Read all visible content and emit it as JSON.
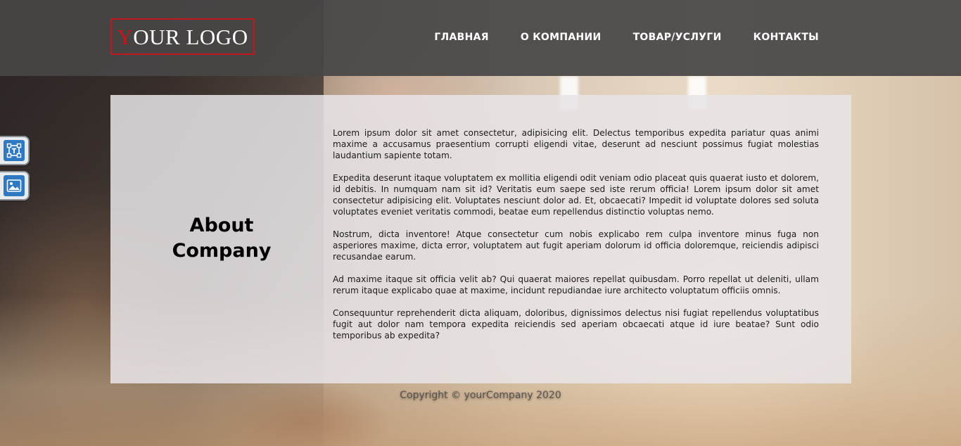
{
  "header": {
    "logo_first": "Y",
    "logo_rest": "OUR LOGO",
    "nav": [
      {
        "label": "ГЛАВНАЯ"
      },
      {
        "label": "О КОМПАНИИ"
      },
      {
        "label": "ТОВАР/УСЛУГИ"
      },
      {
        "label": "КОНТАКТЫ"
      }
    ]
  },
  "side_tools": [
    {
      "icon": "text-frame-icon"
    },
    {
      "icon": "image-icon"
    }
  ],
  "about": {
    "title_line1": "About",
    "title_line2": "Company",
    "paragraphs": [
      "Lorem ipsum dolor sit amet consectetur, adipisicing elit. Delectus temporibus expedita pariatur quas animi maxime a accusamus praesentium corrupti eligendi vitae, deserunt ad nesciunt possimus fugiat molestias laudantium sapiente totam.",
      "Expedita deserunt itaque voluptatem ex mollitia eligendi odit veniam odio placeat quis quaerat iusto et dolorem, id debitis. In numquam nam sit id? Veritatis eum saepe sed iste rerum officia! Lorem ipsum dolor sit amet consectetur adipisicing elit. Voluptates nesciunt dolor ad. Et, obcaecati? Impedit id voluptate dolores sed soluta voluptates eveniet veritatis commodi, beatae eum repellendus distinctio voluptas nemo.",
      "Nostrum, dicta inventore! Atque consectetur cum nobis explicabo rem culpa inventore minus fuga non asperiores maxime, dicta error, voluptatem aut fugit aperiam dolorum id officia doloremque, reiciendis adipisci recusandae earum.",
      "Ad maxime itaque sit officia velit ab? Qui quaerat maiores repellat quibusdam. Porro repellat ut deleniti, ullam rerum itaque explicabo quae at maxime, incidunt repudiandae iure architecto voluptatum officiis omnis.",
      "Consequuntur reprehenderit dicta aliquam, doloribus, dignissimos delectus nisi fugiat repellendus voluptatibus fugit aut dolor nam tempora expedita reiciendis sed aperiam obcaecati atque id iure beatae? Sunt odio temporibus ab expedita?"
    ]
  },
  "footer": {
    "copyright": "Copyright © yourCompany 2020"
  },
  "colors": {
    "header_bg": "#484646",
    "logo_accent": "#c4161c",
    "card_bg": "#e8e4e6",
    "tool_accent": "#2f78c2"
  }
}
